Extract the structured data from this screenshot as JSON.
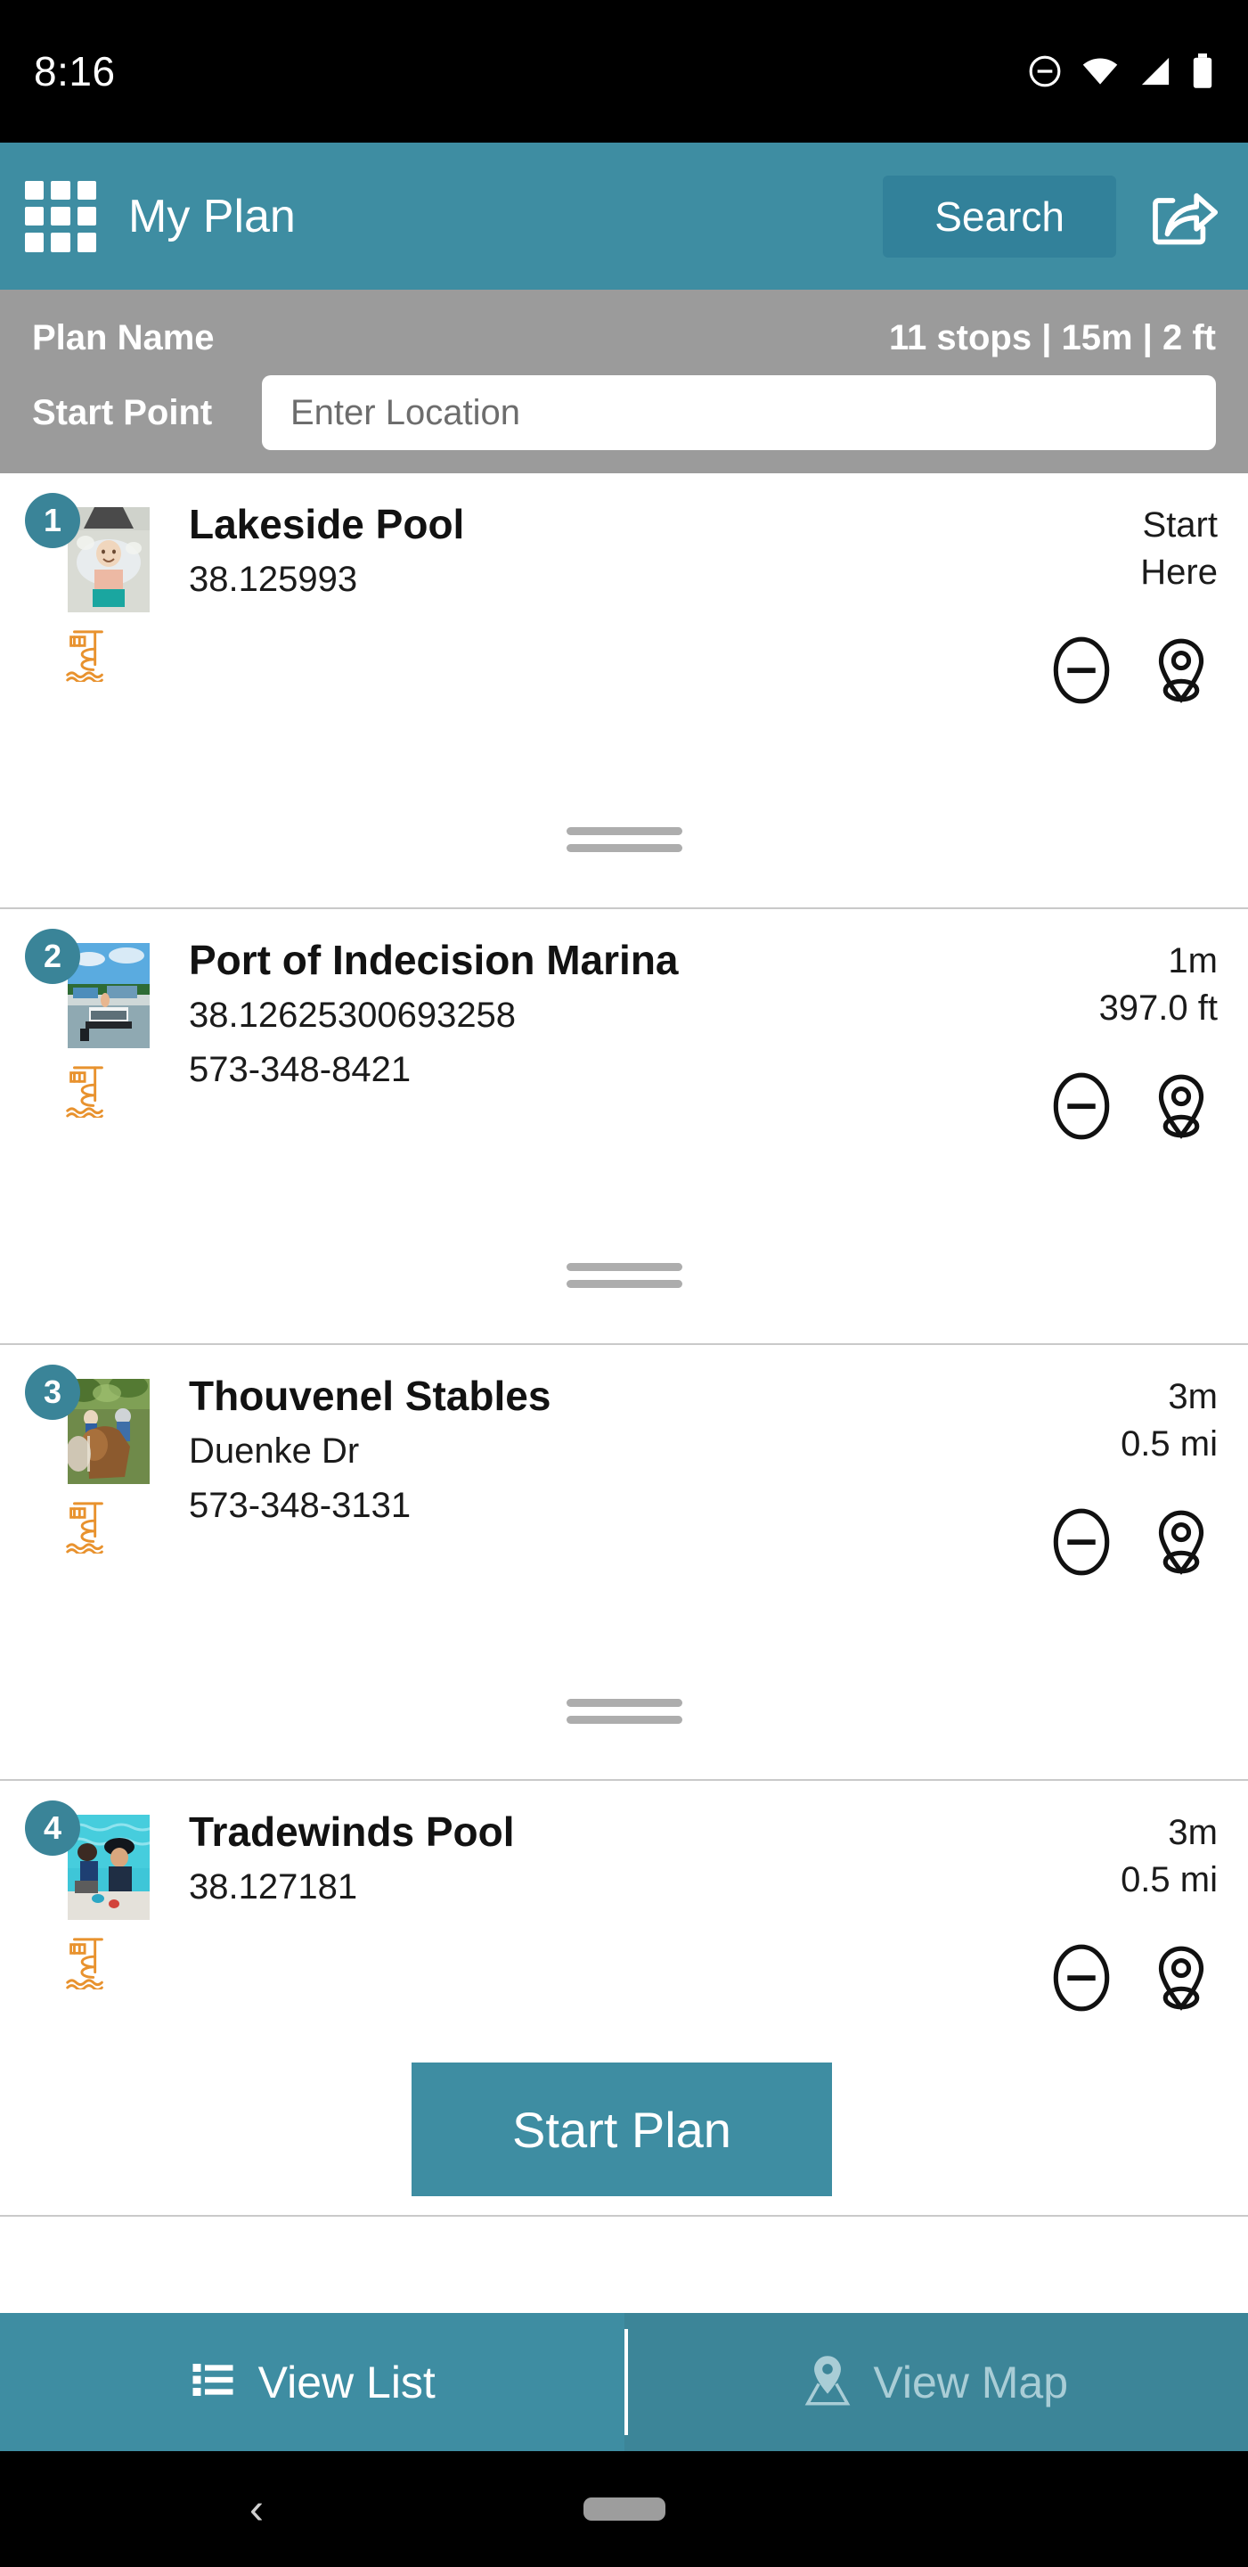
{
  "status_bar": {
    "time": "8:16",
    "icons": [
      "do-not-disturb-icon",
      "wifi-icon",
      "cellular-signal-icon",
      "battery-icon"
    ]
  },
  "header": {
    "menu_icon": "app-grid-icon",
    "title": "My Plan",
    "search_label": "Search",
    "share_icon": "share-icon",
    "accent_color": "#3e8da2",
    "search_button_color": "#32819a"
  },
  "plan_info": {
    "plan_name_label": "Plan Name",
    "stats": "11 stops | 15m | 2 ft",
    "start_point_label": "Start Point",
    "start_point_value": "",
    "start_point_placeholder": "Enter Location",
    "bar_color": "#9b9b9b"
  },
  "stops": [
    {
      "number": "1",
      "title": "Lakeside Pool",
      "line2": "38.125993",
      "line3": "",
      "metric1": "Start",
      "metric2": "Here",
      "category_icon": "water-slide-icon",
      "remove_icon": "minus-circle-icon",
      "locate_icon": "map-pin-icon",
      "drag_handle": "drag-handle"
    },
    {
      "number": "2",
      "title": "Port of Indecision Marina",
      "line2": "38.12625300693258",
      "line3": "573-348-8421",
      "metric1": "1m",
      "metric2": "397.0 ft",
      "category_icon": "water-slide-icon",
      "remove_icon": "minus-circle-icon",
      "locate_icon": "map-pin-icon",
      "drag_handle": "drag-handle"
    },
    {
      "number": "3",
      "title": "Thouvenel Stables",
      "line2": "Duenke Dr",
      "line3": "573-348-3131",
      "metric1": "3m",
      "metric2": "0.5 mi",
      "category_icon": "water-slide-icon",
      "remove_icon": "minus-circle-icon",
      "locate_icon": "map-pin-icon",
      "drag_handle": "drag-handle"
    },
    {
      "number": "4",
      "title": "Tradewinds Pool",
      "line2": "38.127181",
      "line3": "",
      "metric1": "3m",
      "metric2": "0.5 mi",
      "category_icon": "water-slide-icon",
      "remove_icon": "minus-circle-icon",
      "locate_icon": "map-pin-icon",
      "drag_handle": "drag-handle"
    }
  ],
  "start_plan": {
    "label": "Start Plan",
    "color": "#3e8da2"
  },
  "bottom_tabs": {
    "list_label": "View List",
    "list_icon": "list-icon",
    "map_label": "View Map",
    "map_icon": "map-pin-icon",
    "active": "View List"
  },
  "android_nav": {
    "back_icon": "back-chevron-icon",
    "home_pill": "home-pill"
  }
}
